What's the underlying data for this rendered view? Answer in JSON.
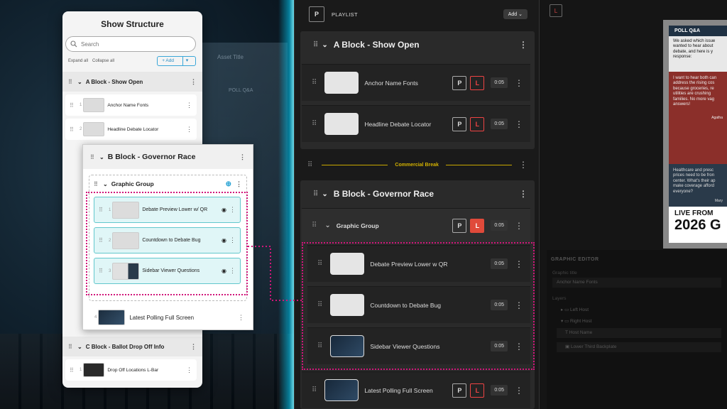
{
  "show_structure": {
    "title": "Show Structure",
    "search_placeholder": "Search",
    "expand_all": "Expand all",
    "collapse_all": "Collapse all",
    "add_label": "+ Add",
    "blocks": [
      {
        "name": "A Block - Show Open",
        "items": [
          {
            "num": "1",
            "name": "Anchor Name Fonts"
          },
          {
            "num": "2",
            "name": "Headline Debate Locator"
          }
        ]
      },
      {
        "name": "C Block - Ballot Drop Off Info",
        "items": [
          {
            "num": "1",
            "name": "Drop Off Locations L-Bar"
          }
        ]
      }
    ]
  },
  "zoom_card": {
    "block_name": "B Block - Governor Race",
    "group_name": "Graphic Group",
    "items": [
      {
        "num": "1",
        "name": "Debate Preview Lower w/ QR"
      },
      {
        "num": "2",
        "name": "Countdown to Debate Bug"
      },
      {
        "num": "3",
        "name": "Sidebar Viewer Questions"
      }
    ],
    "last_item": {
      "num": "4",
      "name": "Latest Polling Full Screen"
    }
  },
  "playlist": {
    "icon_letter": "P",
    "title": "PLAYLIST",
    "add_label": "Add",
    "block_a": {
      "name": "A Block - Show Open",
      "rows": [
        {
          "name": "Anchor Name Fonts",
          "p": "P",
          "l": "L",
          "duration": "0:05"
        },
        {
          "name": "Headline Debate Locator",
          "p": "P",
          "l": "L",
          "duration": "0:05"
        }
      ]
    },
    "commercial_break": "Commercial Break",
    "block_b": {
      "name": "B Block - Governor Race",
      "group": {
        "name": "Graphic Group",
        "p": "P",
        "l": "L",
        "duration": "0:05"
      },
      "rows": [
        {
          "name": "Debate Preview Lower w QR",
          "duration": "0:05"
        },
        {
          "name": "Countdown to Debate Bug",
          "duration": "0:05"
        },
        {
          "name": "Sidebar Viewer Questions",
          "duration": "0:05"
        }
      ],
      "last_row": {
        "name": "Latest Polling Full Screen",
        "p": "P",
        "l": "L",
        "duration": "0:05"
      }
    }
  },
  "preview": {
    "icon_letter": "L",
    "poll_title": "POLL Q&A",
    "poll_question": "We asked which issue wanted to hear about debate, and here is y response:",
    "poll_response": "I want to hear both can address the rising cos because groceries, re utilities are crushing families. No more vag answers!",
    "poll_author": "Agatha",
    "poll_response2": "Healthcare and presc prices need to be fron center. What's their ap make coverage afford everyone?",
    "poll_author2": "Mary",
    "live_from": "LIVE FROM",
    "year": "2026 G"
  },
  "graphic_editor": {
    "title": "GRAPHIC EDITOR",
    "graphic_title_label": "Graphic title",
    "graphic_title_value": "Anchor Name Fonts",
    "layers_label": "Layers",
    "layers": [
      "Left Host",
      "Right Host",
      "Host Name",
      "Lower Third Backplate"
    ]
  },
  "background": {
    "ghost_asset_title": "Asset Title",
    "ghost_poll": "POLL Q&A"
  },
  "colors": {
    "accent_cyan": "#29a3d4",
    "live_red": "#e04a3a",
    "commercial_gold": "#d4b200",
    "highlight_magenta": "#d1167a"
  }
}
